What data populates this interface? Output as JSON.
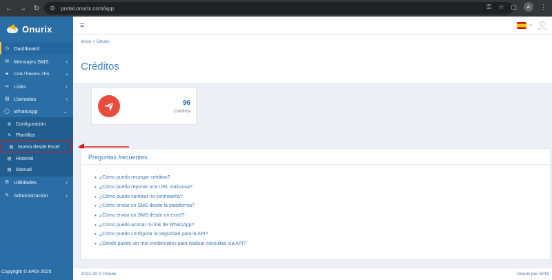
{
  "browser": {
    "url": "portal.onurix.com/app",
    "profile_initial": "A"
  },
  "brand": {
    "name": "Onurix"
  },
  "sidebar": {
    "items": [
      {
        "label": "Dashboard",
        "icon": "dashboard-icon"
      },
      {
        "label": "Mensajes SMS",
        "icon": "sms-icon"
      },
      {
        "label": "Cód./Tokens 2FA",
        "icon": "lock-icon"
      },
      {
        "label": "Links",
        "icon": "link-icon"
      },
      {
        "label": "Llamadas",
        "icon": "phone-icon"
      },
      {
        "label": "WhatsApp",
        "icon": "whatsapp-icon"
      }
    ],
    "whatsapp_sub": [
      {
        "label": "Configuración",
        "icon": "gear-icon"
      },
      {
        "label": "Plantillas",
        "icon": "template-icon"
      },
      {
        "label": "Nuevo desde Excel",
        "icon": "file-icon"
      },
      {
        "label": "Historial",
        "icon": "history-icon"
      },
      {
        "label": "Manual",
        "icon": "book-icon"
      }
    ],
    "bottom_items": [
      {
        "label": "Utilidades",
        "icon": "tools-icon"
      },
      {
        "label": "Administración",
        "icon": "wrench-icon"
      }
    ],
    "footer": "Copyright © APDI 2025"
  },
  "header": {
    "flag": "spain-flag-icon"
  },
  "breadcrumb": "Inicio > Onurix",
  "page_title": "Créditos",
  "credits": {
    "value": "96",
    "label": "Créditos"
  },
  "faq": {
    "title": "Preguntas frecuentes.",
    "items": [
      "¿Cómo puedo recargar créditos?",
      "¿Cómo puedo reportar una URL maliciosa?",
      "¿Cómo puedo cambiar mi contraseña?",
      "¿Cómo enviar un SMS desde la plataforma?",
      "¿Cómo enviar un SMS desde un excel?",
      "¿Cómo puedo acortar mi link de WhatsApp?",
      "¿Cómo puedo configurar la seguridad para la API?",
      "¿Dónde puedo ver mis credenciales para realizar consultas vía API?"
    ]
  },
  "footer": {
    "left": "2014-25 © Onurix",
    "right": "Onurix por APDI"
  },
  "colors": {
    "sidebar": "#2a6ea5",
    "accent": "#3c7cbd",
    "credits_icon": "#e84c3d",
    "annotation": "#e01b1b"
  }
}
